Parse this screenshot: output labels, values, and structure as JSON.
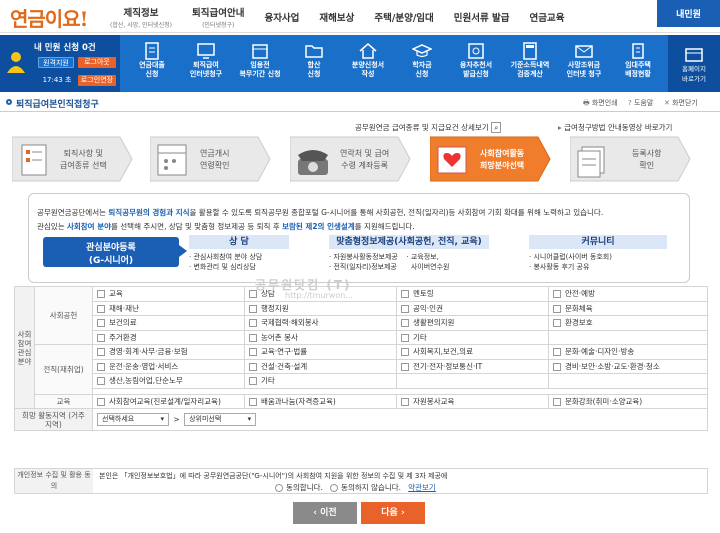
{
  "header": {
    "logo": "연금이요!",
    "nav": [
      {
        "title": "제직정보",
        "sub": "(합산, 사망, 인터넷신청)"
      },
      {
        "title": "퇴직급여안내",
        "sub": "(인터넷청구)"
      },
      {
        "title": "융자사업",
        "sub": ""
      },
      {
        "title": "재해보상",
        "sub": ""
      },
      {
        "title": "주택/분양/임대",
        "sub": ""
      },
      {
        "title": "민원서류 발급",
        "sub": ""
      },
      {
        "title": "연금교육",
        "sub": ""
      }
    ],
    "my_minwon": "내민원"
  },
  "userbar": {
    "count_label": "내 민원 신청 0건",
    "remote": "원격지원",
    "logout": "로그아웃",
    "time": "17:43 초",
    "extend": "로그인연장"
  },
  "services": [
    {
      "l1": "연금대출",
      "l2": "신청"
    },
    {
      "l1": "퇴직급여",
      "l2": "인터넷청구"
    },
    {
      "l1": "임용전",
      "l2": "복무기간 신청"
    },
    {
      "l1": "합산",
      "l2": "신청"
    },
    {
      "l1": "분양신청서",
      "l2": "작성"
    },
    {
      "l1": "학자금",
      "l2": "신청"
    },
    {
      "l1": "융자추천서",
      "l2": "발급신청"
    },
    {
      "l1": "기준소득내역",
      "l2": "검증계산"
    },
    {
      "l1": "사망조위금",
      "l2": "인터넷 청구"
    },
    {
      "l1": "임대주택",
      "l2": "배정현황"
    }
  ],
  "sitemap": {
    "l1": "홈페이지",
    "l2": "바로가기"
  },
  "page": {
    "title": "퇴직급여본인직접청구",
    "print": "화면인쇄",
    "help": "도움말",
    "close": "화면닫기"
  },
  "links": {
    "detail": "공무원연금 급여종류 및 지급요건 상세보기",
    "video": "급여청구방법 안내동영상 바로가기"
  },
  "steps": [
    {
      "l1": "퇴직사항 및",
      "l2": "급여종류 선택"
    },
    {
      "l1": "연금개시",
      "l2": "연령확인"
    },
    {
      "l1": "연락처 및 급여",
      "l2": "수령 계좌등록"
    },
    {
      "l1": "사회참여활동",
      "l2": "희망분야선택"
    },
    {
      "l1": "등록사항",
      "l2": "확인"
    }
  ],
  "intro": {
    "p1a": "공무원연금공단에서는 ",
    "p1b": "퇴직공무원의 경험과 지식",
    "p1c": "을 활용할 수 있도록 퇴직공무원 종합포털 G-시니어를 통해 사회공헌, 전직(일자리)등 사회참여 기회 확대를 위해 노력하고 있습니다.",
    "p2a": "관심있는 ",
    "p2b": "사회참여 분야",
    "p2c": "를 선택해 주시면, 상담 및 맞춤형 정보제공 등 퇴직 후 ",
    "p2d": "보람된 제2의 인생설계",
    "p2e": "를 지원해드립니다.",
    "service_l1": "관심분야등록",
    "service_l2": "(G-시니어)",
    "col1": {
      "head": "상 담",
      "items": [
        "관심사회참여 분야 상담",
        "변화관리 및 심리상담"
      ]
    },
    "col2": {
      "head": "맞춤형정보제공(사회공헌, 전직, 교육)",
      "items": [
        "자원봉사활동정보제공",
        "전직(일자리)정보제공"
      ],
      "items2": [
        "교육정보,",
        "사이버연수원"
      ]
    },
    "col3": {
      "head": "커뮤니티",
      "items": [
        "시니어클럽(사이버 동호회)",
        "봉사활동 후기 공유"
      ]
    }
  },
  "watermark": {
    "l1": "공무원닷컴 (T)",
    "l2": "http://tmurwon..."
  },
  "form": {
    "group1": "사회참여 관심분야",
    "social": "사회공헌",
    "social_items": [
      "교육",
      "상담",
      "멘토링",
      "안전·예방",
      "재해·재난",
      "행정지원",
      "공익·인권",
      "문화체육",
      "보건의료",
      "국제협력·해외봉사",
      "생활편의지원",
      "환경보호",
      "주거환경",
      "농어촌 봉사",
      "기타"
    ],
    "job": "전직(재취업)",
    "job_items": [
      "경영·회계·사무·금융·보험",
      "교육·연구·법률",
      "사회복지,보건,의료",
      "문화·예술·디자인·방송",
      "운전·운송·영업·서비스",
      "건설·건축·설계",
      "전기·전자·정보통신·IT",
      "경비·보안·소방·교도·환경·청소",
      "생산,농림어업,단순노무",
      "기타"
    ],
    "edu": "교육",
    "edu_items": [
      "사회참여교육(진로설계/일자리교육)",
      "배움과나눔(자격증교육)",
      "자원봉사교육",
      "문화강좌(취미·소양교육)"
    ],
    "region_label": "희망 활동지역 (거주지역)",
    "region_sel1": "선택하세요",
    "region_sel2": "상위미선택",
    "agree_label": "개인정보 수집 및 활용 동의",
    "agree_text": "본인은 「개인정보보호법」에 따라 공무원연금공단(\"G-시니어\")의 사회참여 지원을 위한 정보의 수집 및 제 3자 제공에",
    "agree_yes": "동의합니다.",
    "agree_no": "동의하지 않습니다.",
    "agree_more": "약관보기"
  },
  "buttons": {
    "prev": "이전",
    "next": "다음"
  }
}
